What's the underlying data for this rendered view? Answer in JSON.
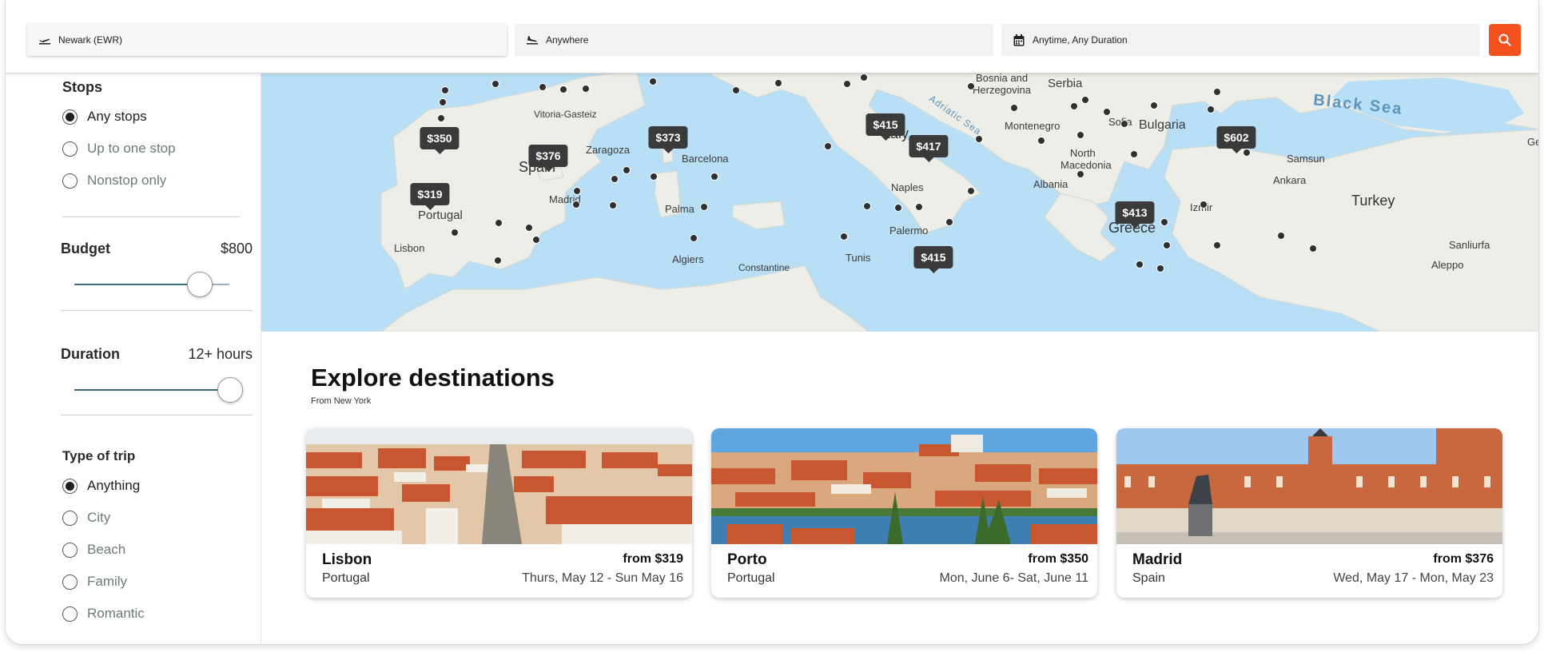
{
  "search": {
    "origin": "Newark (EWR)",
    "destination": "Anywhere",
    "dates": "Anytime, Any Duration"
  },
  "icons": {
    "origin": "plane-takeoff-icon",
    "destination": "plane-landing-icon",
    "dates": "calendar-icon",
    "search": "search-icon"
  },
  "colors": {
    "accent": "#f4511e",
    "slider": "#3e6e84",
    "map_water": "#b8dff6",
    "map_land": "#eef0ea",
    "pin": "#3a3a3a"
  },
  "sidebar": {
    "stops": {
      "title": "Stops",
      "options": [
        {
          "label": "Any stops",
          "selected": true
        },
        {
          "label": "Up to one stop",
          "selected": false
        },
        {
          "label": "Nonstop only",
          "selected": false
        }
      ]
    },
    "budget": {
      "label": "Budget",
      "value": "$800",
      "level_fraction": 0.85
    },
    "duration": {
      "label": "Duration",
      "value": "12+ hours",
      "level_fraction": 1.0
    },
    "trip_type": {
      "title": "Type of trip",
      "options": [
        {
          "label": "Anything",
          "selected": true
        },
        {
          "label": "City",
          "selected": false
        },
        {
          "label": "Beach",
          "selected": false
        },
        {
          "label": "Family",
          "selected": false
        },
        {
          "label": "Romantic",
          "selected": false
        }
      ]
    }
  },
  "map": {
    "price_pins": [
      "$350",
      "$376",
      "$373",
      "$319",
      "$415",
      "$417",
      "$602",
      "$413",
      "$415"
    ],
    "places": [
      "Bosnia and",
      "Herzegovina",
      "Serbia",
      "Vitoria-Gasteiz",
      "Zaragoza",
      "Barcelona",
      "Spain",
      "Madrid",
      "Portugal",
      "Lisbon",
      "Palma",
      "Italy",
      "Naples",
      "Montenegro",
      "Sofia",
      "Bulgaria",
      "North",
      "Macedonia",
      "Albania",
      "Samsun",
      "Ankara",
      "Turkey",
      "Izmir",
      "Palermo",
      "Tunis",
      "Algiers",
      "Constantine",
      "Greece",
      "Sanliurfa",
      "Aleppo",
      "Ge"
    ],
    "seas": [
      "Black Sea",
      "Adriatic Sea"
    ]
  },
  "explore": {
    "title": "Explore destinations",
    "subtitle": "From New York",
    "cards": [
      {
        "city": "Lisbon",
        "country": "Portugal",
        "price": "from $319",
        "dates": "Thurs, May 12 - Sun May 16"
      },
      {
        "city": "Porto",
        "country": "Portugal",
        "price": "from $350",
        "dates": "Mon, June 6- Sat, June 11"
      },
      {
        "city": "Madrid",
        "country": "Spain",
        "price": "from $376",
        "dates": "Wed, May 17 - Mon, May 23"
      }
    ]
  }
}
